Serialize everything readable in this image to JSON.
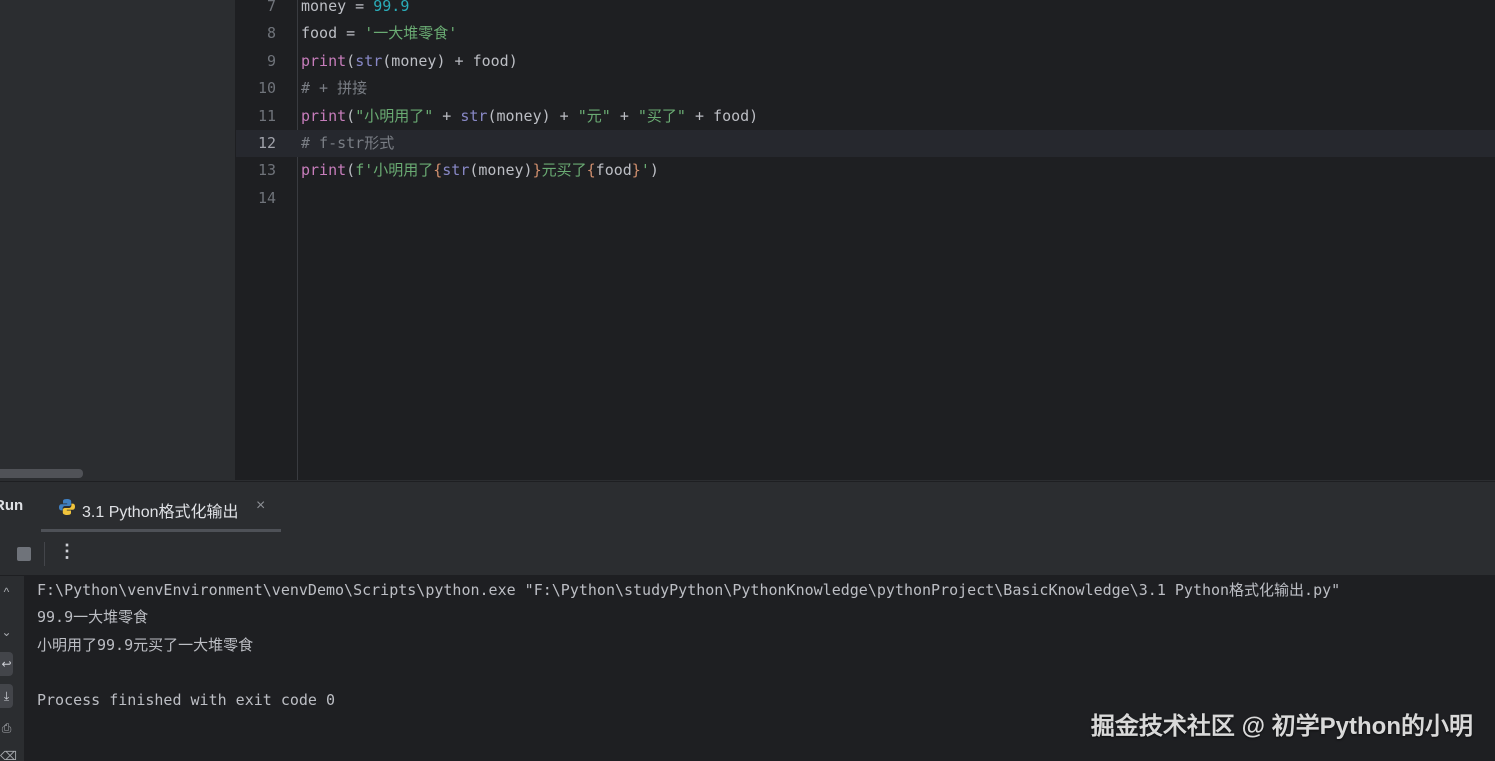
{
  "editor": {
    "current_line": "12",
    "lines": [
      {
        "num": "7",
        "tokens": [
          {
            "t": "money = ",
            "c": "plain"
          },
          {
            "t": "99.9",
            "c": "num"
          }
        ]
      },
      {
        "num": "8",
        "tokens": [
          {
            "t": "food = ",
            "c": "plain"
          },
          {
            "t": "'一大堆零食'",
            "c": "str"
          }
        ]
      },
      {
        "num": "9",
        "tokens": [
          {
            "t": "print",
            "c": "fn"
          },
          {
            "t": "(",
            "c": "plain"
          },
          {
            "t": "str",
            "c": "builtin"
          },
          {
            "t": "(money) + food)",
            "c": "plain"
          }
        ]
      },
      {
        "num": "10",
        "tokens": [
          {
            "t": "# + 拼接",
            "c": "com"
          }
        ]
      },
      {
        "num": "11",
        "tokens": [
          {
            "t": "print",
            "c": "fn"
          },
          {
            "t": "(",
            "c": "plain"
          },
          {
            "t": "\"小明用了\"",
            "c": "str"
          },
          {
            "t": " + ",
            "c": "plain"
          },
          {
            "t": "str",
            "c": "builtin"
          },
          {
            "t": "(money) + ",
            "c": "plain"
          },
          {
            "t": "\"元\"",
            "c": "str"
          },
          {
            "t": " + ",
            "c": "plain"
          },
          {
            "t": "\"买了\"",
            "c": "str"
          },
          {
            "t": " + food)",
            "c": "plain"
          }
        ]
      },
      {
        "num": "12",
        "tokens": [
          {
            "t": "# f-str形式",
            "c": "com"
          }
        ]
      },
      {
        "num": "13",
        "tokens": [
          {
            "t": "print",
            "c": "fn"
          },
          {
            "t": "(",
            "c": "plain"
          },
          {
            "t": "f'小明用了",
            "c": "str"
          },
          {
            "t": "{",
            "c": "brace"
          },
          {
            "t": "str",
            "c": "builtin"
          },
          {
            "t": "(money)",
            "c": "plain"
          },
          {
            "t": "}",
            "c": "brace"
          },
          {
            "t": "元买了",
            "c": "str"
          },
          {
            "t": "{",
            "c": "brace"
          },
          {
            "t": "food",
            "c": "plain"
          },
          {
            "t": "}",
            "c": "brace"
          },
          {
            "t": "'",
            "c": "str"
          },
          {
            "t": ")",
            "c": "plain"
          }
        ]
      },
      {
        "num": "14",
        "tokens": []
      }
    ]
  },
  "run_panel": {
    "label": "Run",
    "tab": {
      "label": "3.1 Python格式化输出",
      "close": "×",
      "icon": "python-icon"
    },
    "toolbar": {
      "stop_icon": "stop-icon",
      "more_icon": "more-vertical-icon",
      "more_glyph": "⋮"
    },
    "side_icons": [
      "wrap-icon",
      "scroll-to-end-icon",
      "print-icon"
    ],
    "console_lines": [
      "F:\\Python\\venvEnvironment\\venvDemo\\Scripts\\python.exe \"F:\\Python\\studyPython\\PythonKnowledge\\pythonProject\\BasicKnowledge\\3.1 Python格式化输出.py\"",
      "99.9一大堆零食",
      "小明用了99.9元买了一大堆零食",
      "",
      "Process finished with exit code 0"
    ]
  },
  "watermark": "掘金技术社区 @ 初学Python的小明",
  "colors": {
    "editor_bg": "#1e1f22",
    "panel_bg": "#2b2d30",
    "keyword_fn": "#c77dbb",
    "builtin": "#8888c6",
    "string": "#6aab73",
    "number": "#2aacb8",
    "comment": "#7a7e85",
    "brace": "#cf8e6d"
  }
}
